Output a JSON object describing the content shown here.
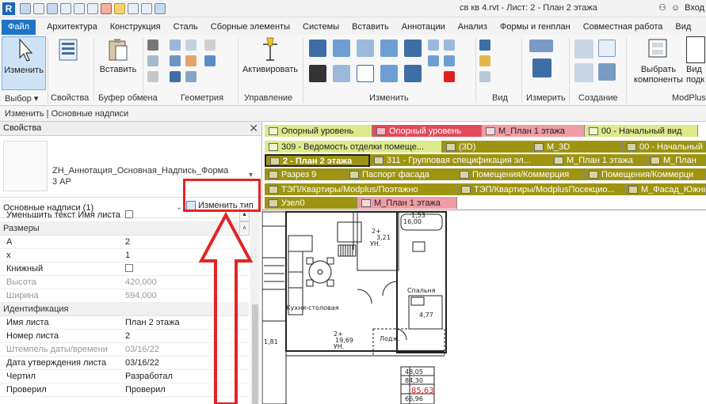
{
  "title_bar": {
    "app_logo": "R",
    "document_title": "св кв 4.rvt - Лист: 2 - План 2 этажа",
    "sign_in": "Вход",
    "icons": [
      "open-icon",
      "save-icon",
      "sync-icon",
      "undo-icon",
      "redo-icon",
      "print-icon",
      "measure-icon",
      "dimension-icon",
      "text-icon",
      "home-icon",
      "switch-windows-icon"
    ]
  },
  "ribbon_tabs": [
    "Файл",
    "Архитектура",
    "Конструкция",
    "Сталь",
    "Сборные элементы",
    "Системы",
    "Вставить",
    "Аннотации",
    "Анализ",
    "Формы и генплан",
    "Совместная работа",
    "Вид"
  ],
  "ribbon": {
    "modify_label": "Изменить",
    "paste_label": "Вставить",
    "activate_label": "Активировать",
    "select_components_label": "Выбрать компоненты",
    "select_components_line1": "Выбрать",
    "select_components_line2": "компоненты",
    "vid_line1": "Вид",
    "vid_line2": "подк",
    "groups": {
      "select": "Выбор ▾",
      "properties": "Свойства",
      "clipboard": "Буфер обмена",
      "geometry": "Геометрия",
      "control": "Управление",
      "modify": "Изменить",
      "view": "Вид",
      "measure": "Измерить",
      "create": "Создание",
      "modplus": "ModPlus"
    }
  },
  "context_bar": "Изменить | Основные надписи",
  "properties": {
    "header": "Свойства",
    "type_name": "ZH_Аннотация_Основная_Надпись_Форма 3 АР",
    "filter_label": "Основные надписи (1)",
    "edit_type_label": "Изменить тип",
    "rows": [
      {
        "kind": "row",
        "label": "Уменьшить текст Имя листа",
        "checkbox": true,
        "value": ""
      },
      {
        "kind": "cat",
        "label": "Размеры"
      },
      {
        "kind": "row",
        "label": "А",
        "value": "2"
      },
      {
        "kind": "row",
        "label": "х",
        "value": "1"
      },
      {
        "kind": "row",
        "label": "Книжный",
        "checkbox": true,
        "value": ""
      },
      {
        "kind": "row",
        "label": "Высота",
        "value": "420,000",
        "grey": true
      },
      {
        "kind": "row",
        "label": "Ширина",
        "value": "594,000",
        "grey": true
      },
      {
        "kind": "cat",
        "label": "Идентификация"
      },
      {
        "kind": "row",
        "label": "Имя листа",
        "value": "План 2  этажа"
      },
      {
        "kind": "row",
        "label": "Номер листа",
        "value": "2"
      },
      {
        "kind": "row",
        "label": "Штемпель даты/времени",
        "value": "03/16/22",
        "grey": true
      },
      {
        "kind": "row",
        "label": "Дата утверждения листа",
        "value": "03/16/22"
      },
      {
        "kind": "row",
        "label": "Чертил",
        "value": "Разработал"
      },
      {
        "kind": "row",
        "label": "Проверил",
        "value": "Проверил"
      }
    ]
  },
  "view_tabs": [
    {
      "label": "Опорный уровень",
      "style": "lime"
    },
    {
      "label": "Опорный уровень",
      "style": "red"
    },
    {
      "label": "М_План 1 этажа",
      "style": "pink"
    },
    {
      "label": "00 - Начальный вид",
      "style": "lime"
    },
    {
      "label": "309 - Ведомость отделки помеще...",
      "style": "lime"
    },
    {
      "label": "(3D)",
      "style": "olive"
    },
    {
      "label": "М_3D",
      "style": "olive"
    },
    {
      "label": "00 - Начальный",
      "style": "olive"
    },
    {
      "label": "2 - План 2  этажа",
      "style": "active"
    },
    {
      "label": "311 - Групповая спецификация эл...",
      "style": "olive"
    },
    {
      "label": "М_План 1 этажа",
      "style": "olive"
    },
    {
      "label": "М_План",
      "style": "olive"
    },
    {
      "label": "Разрез 9",
      "style": "olive"
    },
    {
      "label": "Паспорт фасада",
      "style": "olive"
    },
    {
      "label": "Помещения/Коммерция",
      "style": "olive"
    },
    {
      "label": "Помещения/Коммерци",
      "style": "olive"
    },
    {
      "label": "ТЭП/Квартиры/Modplus/Поэтажно",
      "style": "olive"
    },
    {
      "label": "ТЭП/Квартиры/ModplusПосекцио...",
      "style": "olive"
    },
    {
      "label": "М_Фасад_Южный",
      "style": "olive"
    },
    {
      "label": "Узел0",
      "style": "olive"
    },
    {
      "label": "М_План 1 этажа",
      "style": "pink"
    }
  ],
  "drawing": {
    "labels": [
      "48,05",
      "84,30",
      "85,63",
      "66,96",
      "3,21",
      "19,69",
      "4,77",
      "1,53",
      "16,00",
      "2+",
      "2+",
      "УН.",
      "УН.",
      "Кухня-столовая",
      "Спальня",
      "Лодж.",
      "1,81"
    ]
  },
  "colors": {
    "accent": "#1e74c6",
    "highlight": "#e32424",
    "tab_olive": "#9e9412",
    "tab_lime": "#dde98a",
    "tab_pink": "#ef9ca4",
    "tab_red": "#e34b5a",
    "area_text_red": "#d01f1f"
  }
}
